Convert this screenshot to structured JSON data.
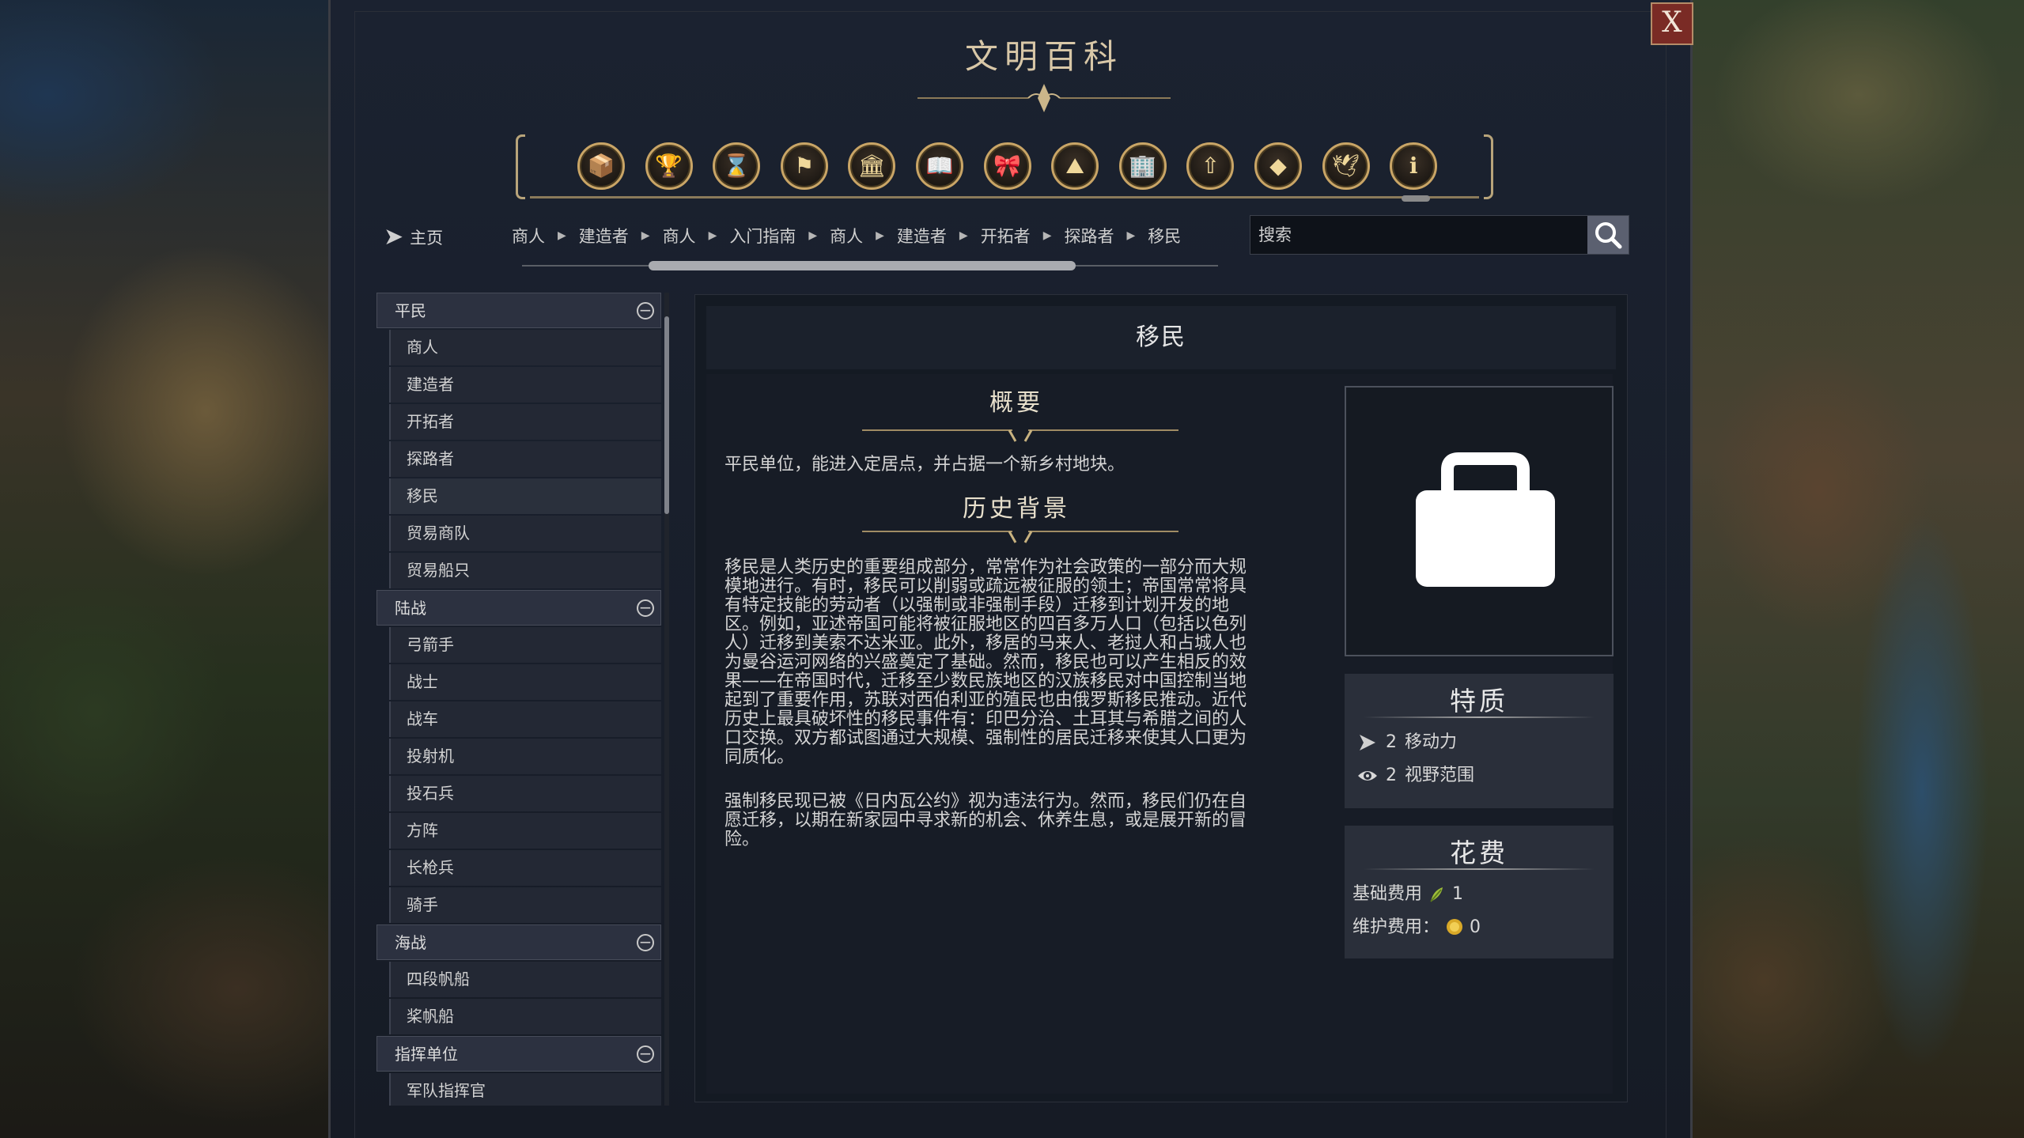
{
  "window": {
    "title": "文明百科",
    "close_label": "X"
  },
  "category_icons": [
    {
      "name": "units-icon",
      "glyph": "📦"
    },
    {
      "name": "goblet-icon",
      "glyph": "🏆"
    },
    {
      "name": "hourglass-icon",
      "glyph": "⌛"
    },
    {
      "name": "flag-icon",
      "glyph": "⚑"
    },
    {
      "name": "temple-icon",
      "glyph": "🏛"
    },
    {
      "name": "book-icon",
      "glyph": "📖"
    },
    {
      "name": "ribbon-icon",
      "glyph": "🎀"
    },
    {
      "name": "mountain-icon",
      "glyph": "⛰"
    },
    {
      "name": "buildings-icon",
      "glyph": "🏢"
    },
    {
      "name": "upgrade-arrow-icon",
      "glyph": "⇧"
    },
    {
      "name": "diamond-icon",
      "glyph": "◆"
    },
    {
      "name": "dove-icon",
      "glyph": "🕊"
    },
    {
      "name": "info-icon",
      "glyph": "ℹ"
    }
  ],
  "nav": {
    "home_label": "主页",
    "breadcrumbs": [
      "商人",
      "建造者",
      "商人",
      "入门指南",
      "商人",
      "建造者",
      "开拓者",
      "探路者",
      "移民"
    ]
  },
  "search": {
    "placeholder": "搜索"
  },
  "sidebar": {
    "groups": [
      {
        "label": "平民",
        "items": [
          "商人",
          "建造者",
          "开拓者",
          "探路者",
          "移民",
          "贸易商队",
          "贸易船只"
        ]
      },
      {
        "label": "陆战",
        "items": [
          "弓箭手",
          "战士",
          "战车",
          "投射机",
          "投石兵",
          "方阵",
          "长枪兵",
          "骑手"
        ]
      },
      {
        "label": "海战",
        "items": [
          "四段帆船",
          "桨帆船"
        ]
      },
      {
        "label": "指挥单位",
        "items": [
          "军队指挥官"
        ]
      }
    ],
    "selected": "移民"
  },
  "article": {
    "title": "移民",
    "overview_heading": "概要",
    "overview_text": "平民单位，能进入定居点，并占据一个新乡村地块。",
    "history_heading": "历史背景",
    "history_lines_1": [
      "移民是人类历史的重要组成部分，常常作为社会政策的一部分而大规",
      "模地进行。有时，移民可以削弱或疏远被征服的领土；帝国常常将具",
      "有特定技能的劳动者（以强制或非强制手段）迁移到计划开发的地",
      "区。例如，亚述帝国可能将被征服地区的四百多万人口（包括以色列",
      "人）迁移到美索不达米亚。此外，移居的马来人、老挝人和占城人也",
      "为曼谷运河网络的兴盛奠定了基础。然而，移民也可以产生相反的效",
      "果——在帝国时代，迁移至少数民族地区的汉族移民对中国控制当地",
      "起到了重要作用，苏联对西伯利亚的殖民也由俄罗斯移民推动。近代",
      "历史上最具破坏性的移民事件有：印巴分治、土耳其与希腊之间的人",
      "口交换。双方都试图通过大规模、强制性的居民迁移来使其人口更为",
      "同质化。"
    ],
    "history_lines_2": [
      "强制移民现已被《日内瓦公约》视为违法行为。然而，移民们仍在自",
      "愿迁移，以期在新家园中寻求新的机会、休养生息，或是展开新的冒",
      "险。"
    ]
  },
  "traits": {
    "heading": "特质",
    "movement": {
      "value": "2",
      "label": "移动力"
    },
    "sight": {
      "value": "2",
      "label": "视野范围"
    }
  },
  "cost": {
    "heading": "花费",
    "base_label": "基础费用",
    "base_value": "1",
    "maintenance_label": "维护费用：",
    "maintenance_value": "0"
  },
  "colors": {
    "accent_gold": "#c9a566",
    "close_red": "#7a2b25",
    "panel_bg": "#181e2a"
  }
}
